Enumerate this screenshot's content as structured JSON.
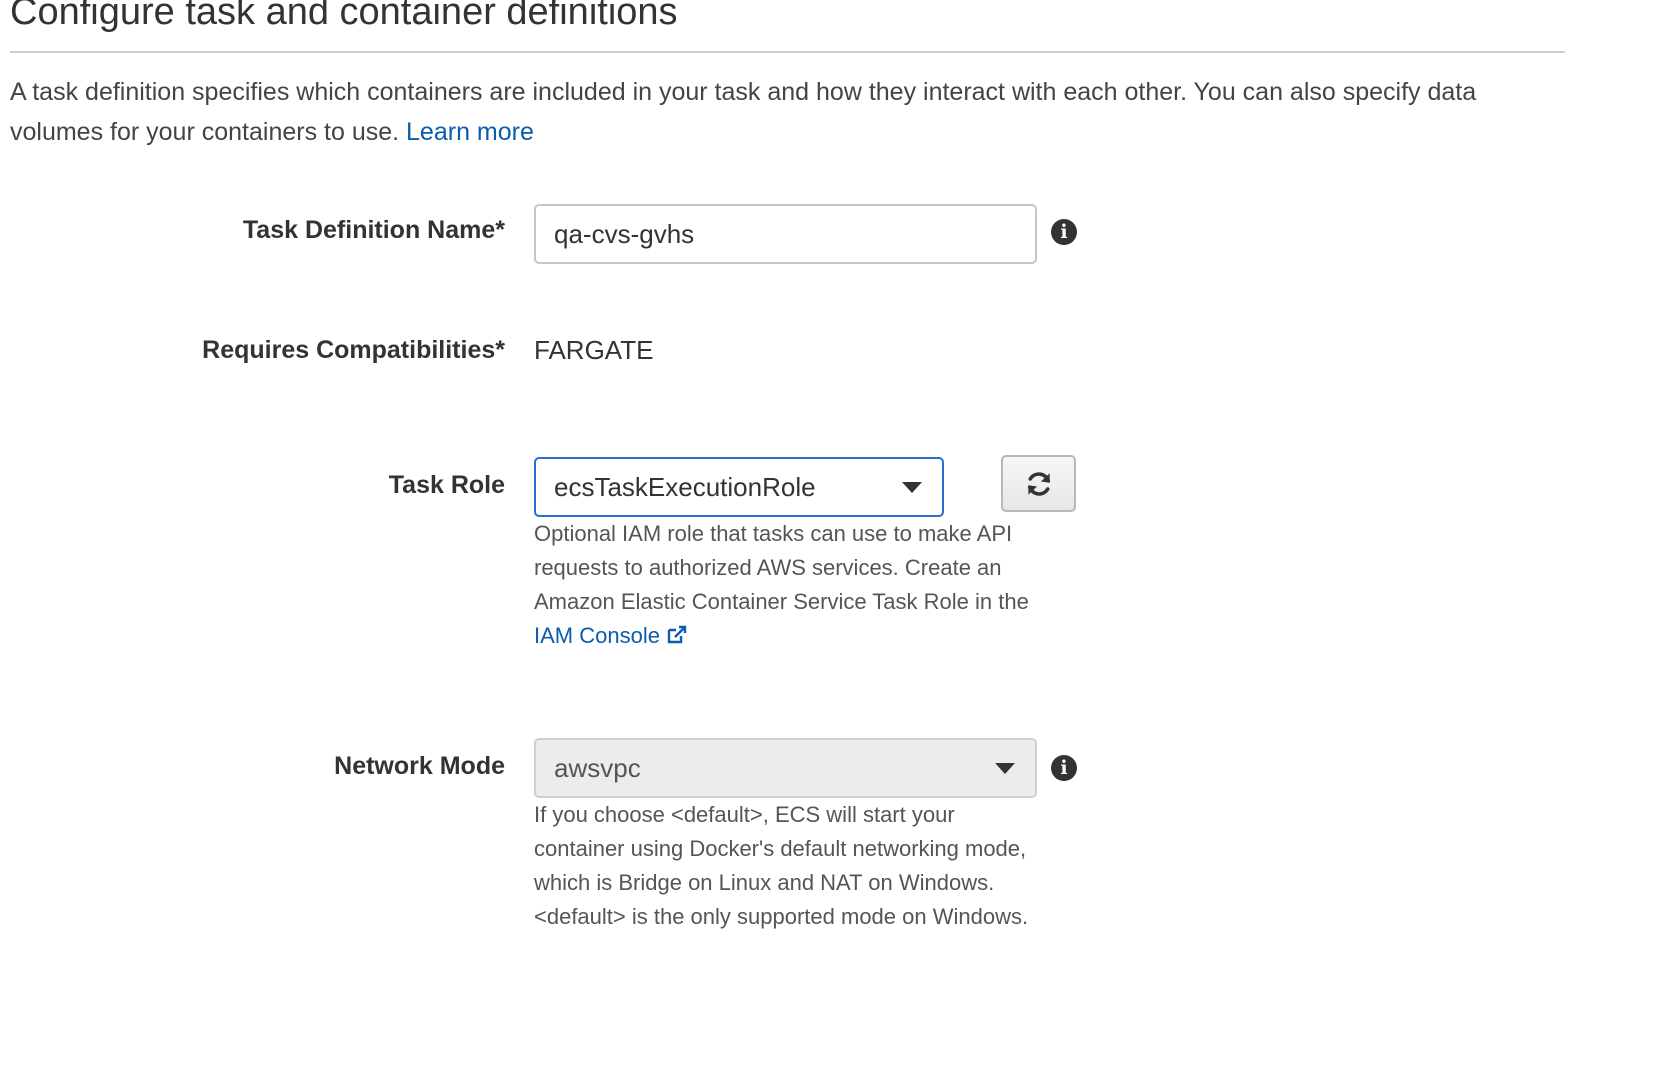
{
  "page": {
    "title": "Configure task and container definitions",
    "intro_text": "A task definition specifies which containers are included in your task and how they interact with each other. You can also specify data volumes for your containers to use.",
    "learn_more_link": "Learn more"
  },
  "form": {
    "task_definition_name": {
      "label": "Task Definition Name*",
      "value": "qa-cvs-gvhs",
      "info_icon": "info-icon"
    },
    "requires_compatibilities": {
      "label": "Requires Compatibilities*",
      "value": "FARGATE"
    },
    "task_role": {
      "label": "Task Role",
      "selected": "ecsTaskExecutionRole",
      "refresh_icon": "refresh-icon",
      "help_text": "Optional IAM role that tasks can use to make API requests to authorized AWS services. Create an Amazon Elastic Container Service Task Role in the",
      "help_link": "IAM Console",
      "help_link_icon": "external-link-icon"
    },
    "network_mode": {
      "label": "Network Mode",
      "selected": "awsvpc",
      "disabled": true,
      "info_icon": "info-icon",
      "help_text": "If you choose <default>, ECS will start your container using Docker's default networking mode, which is Bridge on Linux and NAT on Windows. <default> is the only supported mode on Windows."
    }
  },
  "colors": {
    "link": "#0b5cad",
    "focus_border": "#2a6fcf",
    "disabled_bg": "#ececec",
    "text": "#444444"
  }
}
